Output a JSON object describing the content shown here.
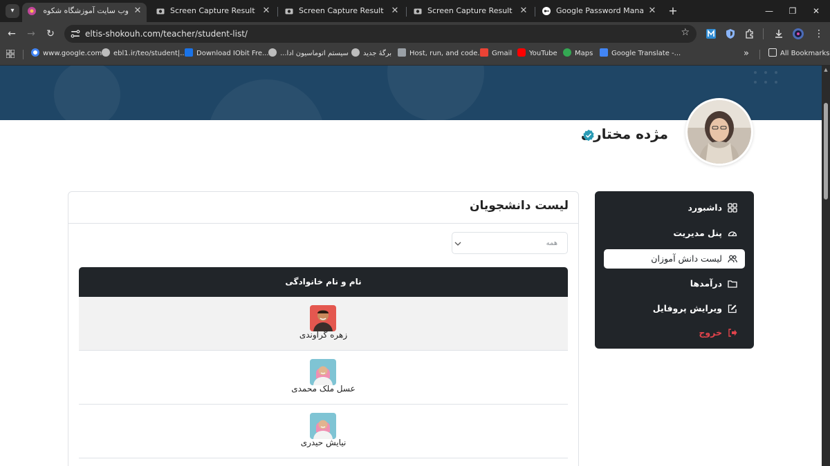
{
  "browser": {
    "tabs": [
      {
        "title": "وب سایت آموزشگاه شکوه دماوند",
        "active": true
      },
      {
        "title": "Screen Capture Result",
        "active": false
      },
      {
        "title": "Screen Capture Result",
        "active": false
      },
      {
        "title": "Screen Capture Result",
        "active": false
      },
      {
        "title": "Google Password Manager",
        "active": false
      }
    ],
    "new_tab": "+",
    "url": "eltis-shokouh.com/teacher/student-list/",
    "bookmarks": [
      "www.google.com",
      "ebl1.ir/teo/student|...",
      "Download IObit Fre...",
      "سیستم اتوماسیون ادا...",
      "برگهٔ جدید",
      "Host, run, and code...",
      "Gmail",
      "YouTube",
      "Maps",
      "Google Translate -..."
    ],
    "overflow": "»",
    "all_bookmarks": "All Bookmarks"
  },
  "profile": {
    "name": "مژده مختاری"
  },
  "sidebar": {
    "items": [
      {
        "label": "داشبورد",
        "icon": "dashboard-grid-icon"
      },
      {
        "label": "پنل مدیریت",
        "icon": "gauge-icon"
      },
      {
        "label": "لیست دانش آموزان",
        "icon": "users-icon",
        "active": true
      },
      {
        "label": "درآمدها",
        "icon": "folder-icon"
      },
      {
        "label": "ویرایش پروفایل",
        "icon": "edit-icon"
      },
      {
        "label": "خروج",
        "icon": "logout-icon"
      }
    ]
  },
  "main": {
    "title": "لیست دانشجویان",
    "filter": {
      "value": "همه"
    },
    "table": {
      "header": "نام و نام خانوادگی",
      "rows": [
        {
          "name": "زهره گراوندی"
        },
        {
          "name": "عسل ملک محمدی"
        },
        {
          "name": "نیایش حیدری"
        }
      ]
    }
  },
  "colors": {
    "banner": "#1f4666",
    "sidebar_bg": "#212529",
    "logout": "#e0434b",
    "verified": "#2a9bb5"
  }
}
